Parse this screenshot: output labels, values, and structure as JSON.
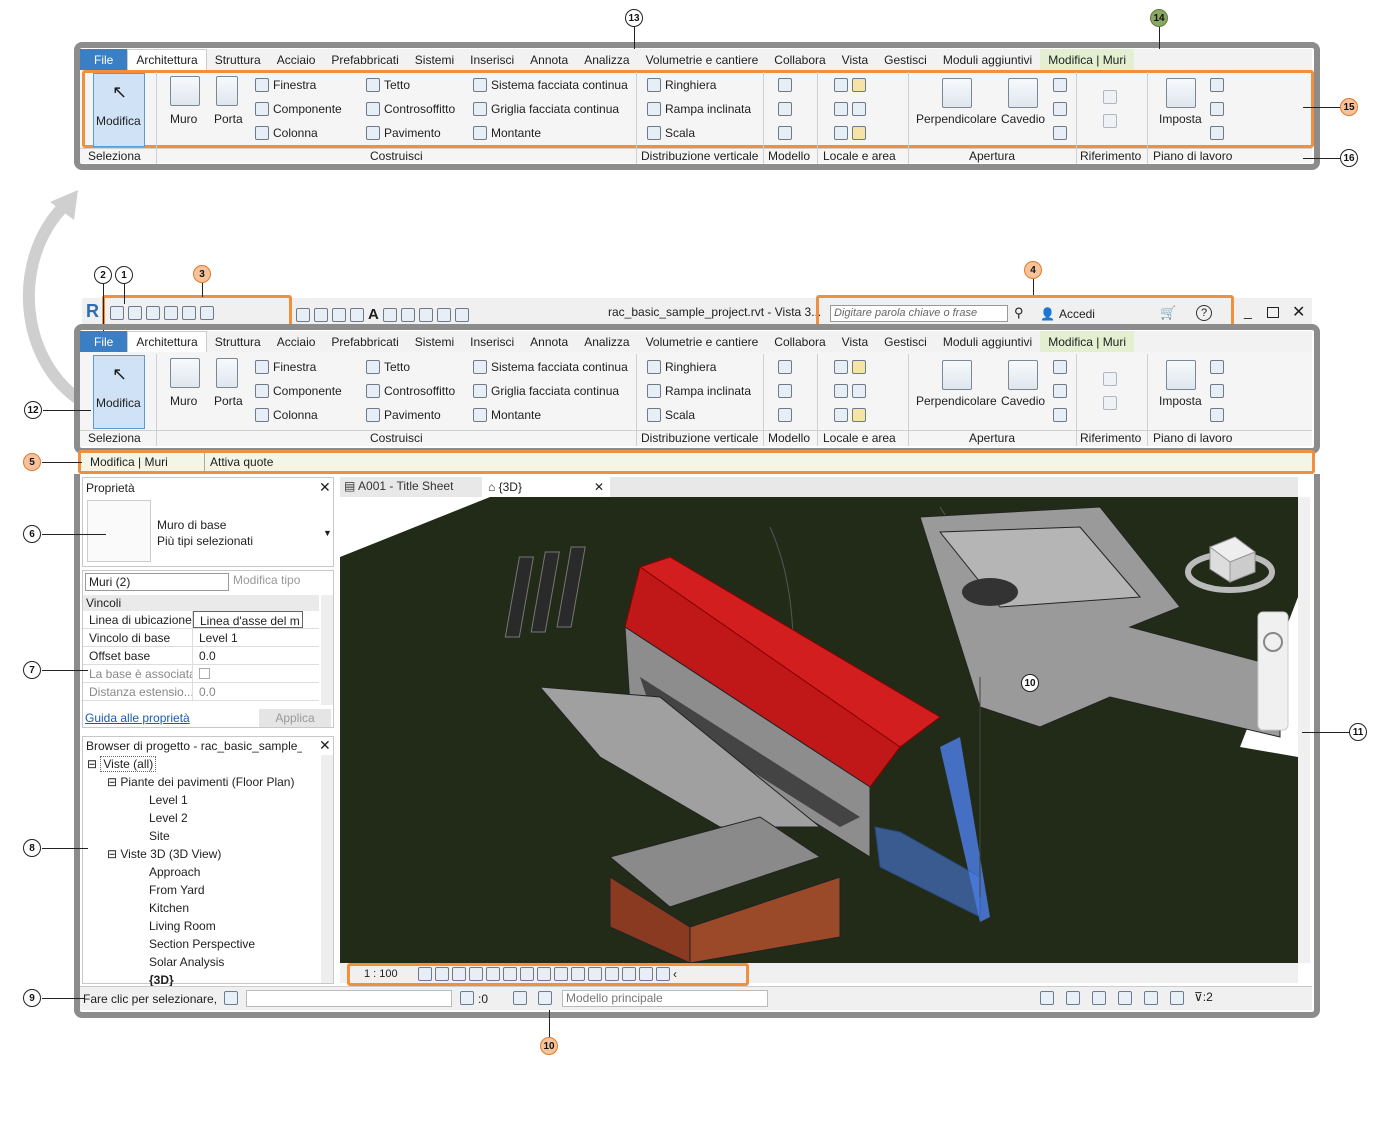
{
  "tabs": [
    "File",
    "Architettura",
    "Struttura",
    "Acciaio",
    "Prefabbricati",
    "Sistemi",
    "Inserisci",
    "Annota",
    "Analizza",
    "Volumetrie e cantiere",
    "Collabora",
    "Vista",
    "Gestisci",
    "Moduli aggiuntivi",
    "Modifica | Muri"
  ],
  "ribbon": {
    "modifica": "Modifica",
    "muro": "Muro",
    "porta": "Porta",
    "finestra": "Finestra",
    "componente": "Componente",
    "colonna": "Colonna",
    "tetto": "Tetto",
    "controsoffitto": "Controsoffitto",
    "pavimento": "Pavimento",
    "sistema_facciata": "Sistema facciata continua",
    "griglia_facciata": "Griglia facciata continua",
    "montante": "Montante",
    "ringhiera": "Ringhiera",
    "rampa": "Rampa inclinata",
    "scala": "Scala",
    "perpendicolare": "Perpendicolare",
    "cavedio": "Cavedio",
    "imposta": "Imposta",
    "panels": {
      "seleziona": "Seleziona",
      "costruisci": "Costruisci",
      "distribuzione": "Distribuzione verticale",
      "modello": "Modello",
      "locale": "Locale e area",
      "apertura": "Apertura",
      "riferimento": "Riferimento",
      "piano": "Piano di lavoro"
    }
  },
  "qat": {
    "filename": "rac_basic_sample_project.rvt - Vista 3...",
    "search_placeholder": "Digitare parola chiave o frase",
    "accedi": "Accedi"
  },
  "options_bar": {
    "context": "Modifica | Muri",
    "attiva_quote": "Attiva quote"
  },
  "properties": {
    "title": "Proprietà",
    "type_name": "Muro di base",
    "type_sub": "Più tipi selezionati",
    "selector": "Muri (2)",
    "edit_type": "Modifica tipo",
    "group": "Vincoli",
    "rows": [
      {
        "name": "Linea di ubicazione",
        "value": "Linea d'asse del m"
      },
      {
        "name": "Vincolo di base",
        "value": "Level 1"
      },
      {
        "name": "Offset base",
        "value": "0.0"
      },
      {
        "name": "La base è associata",
        "value": ""
      },
      {
        "name": "Distanza estensio...",
        "value": "0.0"
      }
    ],
    "help": "Guida alle proprietà",
    "apply": "Applica"
  },
  "browser": {
    "title": "Browser di progetto - rac_basic_sample_p...",
    "items": [
      "Viste (all)",
      "Piante dei pavimenti (Floor Plan)",
      "Level 1",
      "Level 2",
      "Site",
      "Viste 3D (3D View)",
      "Approach",
      "From Yard",
      "Kitchen",
      "Living Room",
      "Section Perspective",
      "Solar Analysis",
      "{3D}"
    ]
  },
  "view_tabs": [
    "A001 - Title Sheet",
    "{3D}"
  ],
  "view_bar": {
    "scale": "1 : 100"
  },
  "status": {
    "text": "Fare clic per selezionare, p",
    "count": ":0",
    "model": "Modello principale",
    "filter": ":2"
  },
  "callouts": [
    "1",
    "2",
    "3",
    "4",
    "5",
    "6",
    "7",
    "8",
    "9",
    "10",
    "11",
    "12",
    "13",
    "14",
    "15",
    "16"
  ],
  "colors": {
    "accent_orange": "#f0903c",
    "frame_gray": "#8c8c8c",
    "file_blue": "#3a7ec4",
    "roof_red": "#d21e1e",
    "context_green": "#e3efd0"
  }
}
